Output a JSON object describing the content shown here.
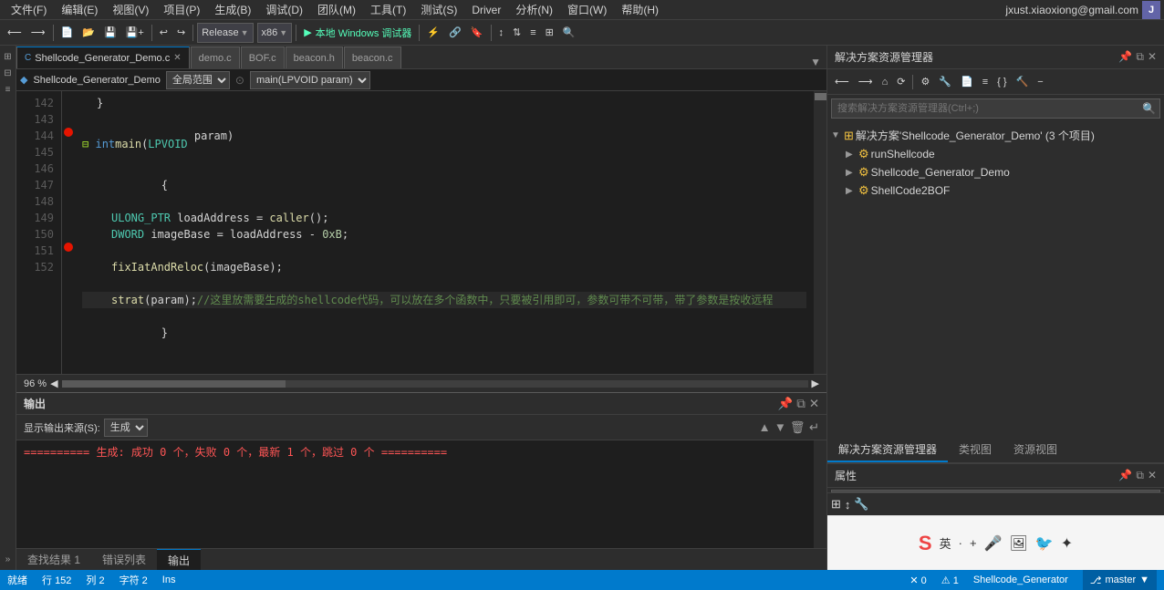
{
  "menubar": {
    "items": [
      "文件(F)",
      "编辑(E)",
      "视图(V)",
      "项目(P)",
      "生成(B)",
      "调试(D)",
      "团队(M)",
      "工具(T)",
      "测试(S)",
      "Driver",
      "分析(N)",
      "窗口(W)",
      "帮助(H)"
    ],
    "user_email": "jxust.xiaoxiong@gmail.com",
    "user_initial": "J"
  },
  "toolbar": {
    "back_label": "◀",
    "forward_label": "▶",
    "config_label": "Release",
    "platform_label": "x86",
    "run_label": "▶",
    "run_text": "本地 Windows 调试器",
    "pause_label": "⏸"
  },
  "tabs": [
    {
      "label": "Shellcode_Generator_Demo.c",
      "active": true,
      "modified": false,
      "closable": true
    },
    {
      "label": "demo.c",
      "active": false,
      "closable": false
    },
    {
      "label": "BOF.c",
      "active": false,
      "closable": false
    },
    {
      "label": "beacon.h",
      "active": false,
      "closable": false
    },
    {
      "label": "beacon.c",
      "active": false,
      "closable": false
    }
  ],
  "code_toolbar": {
    "scope_label": "全局范围",
    "function_label": "main(LPVOID param)"
  },
  "code_lines": [
    {
      "num": "142",
      "indent": 1,
      "text": "}"
    },
    {
      "num": "143",
      "indent": 0,
      "text": ""
    },
    {
      "num": "144",
      "indent": 0,
      "has_bp": true,
      "text": "int main(LPVOID param)"
    },
    {
      "num": "145",
      "indent": 0,
      "text": "{"
    },
    {
      "num": "146",
      "indent": 2,
      "text": "ULONG_PTR loadAddress = caller();"
    },
    {
      "num": "147",
      "indent": 2,
      "text": "DWORD imageBase = loadAddress - 0xB;"
    },
    {
      "num": "148",
      "indent": 0,
      "text": ""
    },
    {
      "num": "149",
      "indent": 2,
      "text": "fixIatAndReloc(imageBase);"
    },
    {
      "num": "150",
      "indent": 0,
      "text": ""
    },
    {
      "num": "151",
      "indent": 2,
      "has_bp": true,
      "text": "strat(param);//这里放需要生成的shellcode代码，可以放在多个函数中，只要被引用即可，参数可带不可带，带了参数是按收远程"
    },
    {
      "num": "152",
      "indent": 0,
      "text": "}"
    }
  ],
  "zoom": "96 %",
  "right_panel": {
    "title": "解决方案资源管理器",
    "search_placeholder": "搜索解决方案资源管理器(Ctrl+;)",
    "solution_label": "解决方案'Shellcode_Generator_Demo' (3 个项目)",
    "projects": [
      {
        "name": "runShellcode",
        "indent": 1,
        "expanded": false
      },
      {
        "name": "Shellcode_Generator_Demo",
        "indent": 1,
        "expanded": true
      },
      {
        "name": "ShellCode2BOF",
        "indent": 1,
        "expanded": false
      }
    ],
    "panel_tabs": [
      "解决方案资源管理器",
      "类视图",
      "资源视图"
    ],
    "active_panel_tab": 0
  },
  "properties_panel": {
    "title": "属性"
  },
  "output_panel": {
    "title": "输出",
    "source_label": "显示输出来源(S):",
    "source_value": "生成",
    "content": "========== 生成: 成功 0 个，失败 0 个，最新 1 个，跳过 0 个 =========="
  },
  "output_tabs": [
    {
      "label": "查找结果 1",
      "active": false
    },
    {
      "label": "错误列表",
      "active": false
    },
    {
      "label": "输出",
      "active": true
    }
  ],
  "statusbar": {
    "ready": "就绪",
    "row_label": "行",
    "row_value": "152",
    "col_label": "列",
    "col_value": "2",
    "char_label": "字符",
    "char_value": "2",
    "ins_label": "Ins",
    "error_count": "0",
    "warning_count": "1",
    "project": "Shellcode_Generator",
    "branch": "master"
  }
}
